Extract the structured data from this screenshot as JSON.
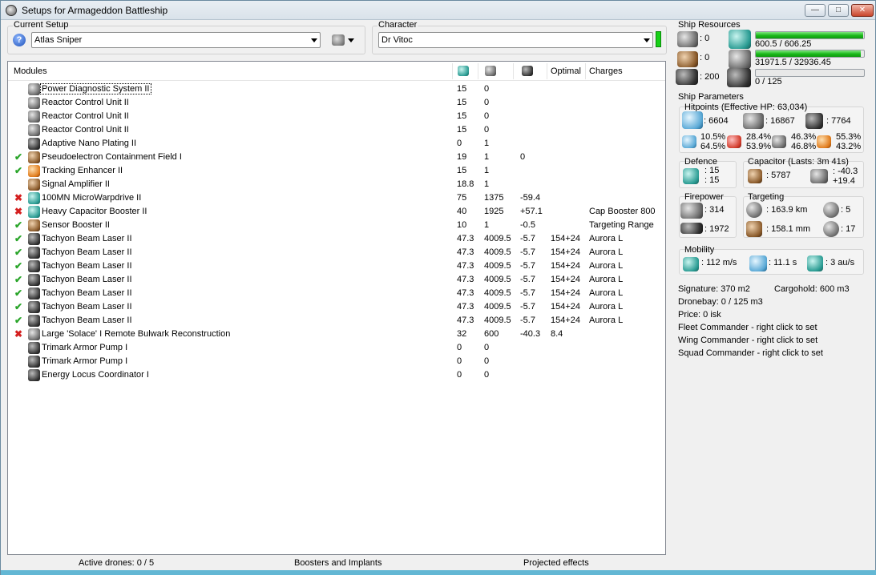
{
  "window": {
    "title": "Setups for Armageddon Battleship",
    "buttons": {
      "minimize": "—",
      "maximize": "□",
      "close": "✕"
    }
  },
  "setup": {
    "label": "Current Setup",
    "value": "Atlas Sniper",
    "help_icon": "question-icon",
    "tool_icon": "tools-icon"
  },
  "character": {
    "label": "Character",
    "value": "Dr Vitoc",
    "indicator_color": "#18d018"
  },
  "modules": {
    "header": {
      "name": "Modules",
      "col1_icon": "cpu-icon",
      "col2_icon": "powergrid-icon",
      "col3_icon": "capacitor-icon",
      "col4": "Optimal",
      "col5": "Charges"
    },
    "rows": [
      {
        "status": "",
        "icon": "power-diagnostic-icon",
        "name": "Power Diagnostic System II",
        "cpu": "15",
        "pg": "0",
        "cap": "",
        "optimal": "",
        "charges": "",
        "focused": true
      },
      {
        "status": "",
        "icon": "reactor-control-icon",
        "name": "Reactor Control Unit II",
        "cpu": "15",
        "pg": "0",
        "cap": "",
        "optimal": "",
        "charges": ""
      },
      {
        "status": "",
        "icon": "reactor-control-icon",
        "name": "Reactor Control Unit II",
        "cpu": "15",
        "pg": "0",
        "cap": "",
        "optimal": "",
        "charges": ""
      },
      {
        "status": "",
        "icon": "reactor-control-icon",
        "name": "Reactor Control Unit II",
        "cpu": "15",
        "pg": "0",
        "cap": "",
        "optimal": "",
        "charges": ""
      },
      {
        "status": "",
        "icon": "armor-plating-icon",
        "name": "Adaptive Nano Plating II",
        "cpu": "0",
        "pg": "1",
        "cap": "",
        "optimal": "",
        "charges": ""
      },
      {
        "status": "ok",
        "icon": "pseudoelectron-icon",
        "name": "Pseudoelectron Containment Field I",
        "cpu": "19",
        "pg": "1",
        "cap": "0",
        "optimal": "",
        "charges": ""
      },
      {
        "status": "ok",
        "icon": "tracking-enhancer-icon",
        "name": "Tracking Enhancer II",
        "cpu": "15",
        "pg": "1",
        "cap": "",
        "optimal": "",
        "charges": ""
      },
      {
        "status": "",
        "icon": "signal-amplifier-icon",
        "name": "Signal Amplifier II",
        "cpu": "18.8",
        "pg": "1",
        "cap": "",
        "optimal": "",
        "charges": ""
      },
      {
        "status": "no",
        "icon": "microwarpdrive-icon",
        "name": "100MN MicroWarpdrive II",
        "cpu": "75",
        "pg": "1375",
        "cap": "-59.4",
        "optimal": "",
        "charges": ""
      },
      {
        "status": "no",
        "icon": "cap-booster-icon",
        "name": "Heavy Capacitor Booster II",
        "cpu": "40",
        "pg": "1925",
        "cap": "+57.1",
        "optimal": "",
        "charges": "Cap Booster 800"
      },
      {
        "status": "ok",
        "icon": "sensor-booster-icon",
        "name": "Sensor Booster II",
        "cpu": "10",
        "pg": "1",
        "cap": "-0.5",
        "optimal": "",
        "charges": "Targeting Range"
      },
      {
        "status": "ok",
        "icon": "beam-laser-icon",
        "name": "Tachyon Beam Laser II",
        "cpu": "47.3",
        "pg": "4009.5",
        "cap": "-5.7",
        "optimal": "154+24",
        "charges": "Aurora L"
      },
      {
        "status": "ok",
        "icon": "beam-laser-icon",
        "name": "Tachyon Beam Laser II",
        "cpu": "47.3",
        "pg": "4009.5",
        "cap": "-5.7",
        "optimal": "154+24",
        "charges": "Aurora L"
      },
      {
        "status": "ok",
        "icon": "beam-laser-icon",
        "name": "Tachyon Beam Laser II",
        "cpu": "47.3",
        "pg": "4009.5",
        "cap": "-5.7",
        "optimal": "154+24",
        "charges": "Aurora L"
      },
      {
        "status": "ok",
        "icon": "beam-laser-icon",
        "name": "Tachyon Beam Laser II",
        "cpu": "47.3",
        "pg": "4009.5",
        "cap": "-5.7",
        "optimal": "154+24",
        "charges": "Aurora L"
      },
      {
        "status": "ok",
        "icon": "beam-laser-icon",
        "name": "Tachyon Beam Laser II",
        "cpu": "47.3",
        "pg": "4009.5",
        "cap": "-5.7",
        "optimal": "154+24",
        "charges": "Aurora L"
      },
      {
        "status": "ok",
        "icon": "beam-laser-icon",
        "name": "Tachyon Beam Laser II",
        "cpu": "47.3",
        "pg": "4009.5",
        "cap": "-5.7",
        "optimal": "154+24",
        "charges": "Aurora L"
      },
      {
        "status": "ok",
        "icon": "beam-laser-icon",
        "name": "Tachyon Beam Laser II",
        "cpu": "47.3",
        "pg": "4009.5",
        "cap": "-5.7",
        "optimal": "154+24",
        "charges": "Aurora L"
      },
      {
        "status": "no",
        "icon": "remote-repair-icon",
        "name": "Large 'Solace' I Remote Bulwark Reconstruction",
        "cpu": "32",
        "pg": "600",
        "cap": "-40.3",
        "optimal": "8.4",
        "charges": ""
      },
      {
        "status": "",
        "icon": "armor-pump-icon",
        "name": "Trimark Armor Pump I",
        "cpu": "0",
        "pg": "0",
        "cap": "",
        "optimal": "",
        "charges": ""
      },
      {
        "status": "",
        "icon": "armor-pump-icon",
        "name": "Trimark Armor Pump I",
        "cpu": "0",
        "pg": "0",
        "cap": "",
        "optimal": "",
        "charges": ""
      },
      {
        "status": "",
        "icon": "energy-locus-icon",
        "name": "Energy Locus Coordinator I",
        "cpu": "0",
        "pg": "0",
        "cap": "",
        "optimal": "",
        "charges": ""
      }
    ]
  },
  "statusbar": {
    "drones": "Active drones: 0 / 5",
    "boosters": "Boosters and Implants",
    "projected": "Projected effects"
  },
  "resources": {
    "label": "Ship Resources",
    "turrets": ": 0",
    "launchers": ": 0",
    "calibration": ": 200",
    "cpu": {
      "text": "600.5 / 606.25",
      "fraction": 0.99
    },
    "powergrid": {
      "text": "31971.5 / 32936.45",
      "fraction": 0.97
    },
    "drone_bandwidth": {
      "text": "0 / 125",
      "fraction": 0
    }
  },
  "params": {
    "label": "Ship Parameters",
    "hitpoints_label": "Hitpoints (Effective HP: 63,034)",
    "shield_hp": ": 6604",
    "armor_hp": ": 16867",
    "structure_hp": ": 7764",
    "res": {
      "em": [
        "10.5%",
        "64.5%"
      ],
      "thermal": [
        "28.4%",
        "53.9%"
      ],
      "kinetic": [
        "46.3%",
        "46.8%"
      ],
      "explosive": [
        "55.3%",
        "43.2%"
      ]
    },
    "defence": {
      "label": "Defence",
      "line1": ": 15",
      "line2": ": 15"
    },
    "capacitor": {
      "label": "Capacitor (Lasts: 3m 41s)",
      "amount": ": 5787",
      "delta1": ": -40.3",
      "delta2": "+19.4"
    },
    "firepower": {
      "label": "Firepower",
      "dps": ": 314",
      "volley": ": 1972"
    },
    "targeting": {
      "label": "Targeting",
      "range": ": 163.9 km",
      "max_targets": ": 5",
      "scan_res": ": 158.1 mm",
      "sensor_strength": ": 17"
    },
    "mobility": {
      "label": "Mobility",
      "speed": ": 112 m/s",
      "align": ": 11.1 s",
      "warp": ": 3 au/s"
    },
    "signature": "Signature: 370 m2",
    "cargohold": "Cargohold: 600 m3",
    "dronebay": "Dronebay: 0 / 125 m3",
    "price": "Price: 0 isk",
    "fleet": "Fleet Commander - right click to set",
    "wing": "Wing Commander - right click to set",
    "squad": "Squad Commander - right click to set"
  }
}
